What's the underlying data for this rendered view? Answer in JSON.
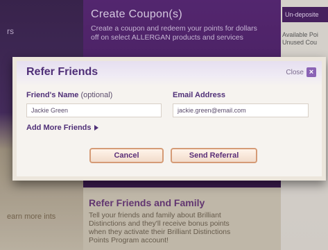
{
  "background": {
    "left_text": "rs",
    "left_bottom_text": "earn more ints",
    "coupon": {
      "title": "Create Coupon(s)",
      "description": "Create a coupon and redeem your points for dollars off on select ALLERGAN products and services"
    },
    "right_panel": {
      "undeposited_label": "Un-deposite",
      "available_text": "Available Poi\nUnused Cou"
    },
    "refer_section": {
      "title": "Refer Friends and Family",
      "description": "Tell your friends and family about Brilliant Distinctions and they'll receive bonus points when they activate their Brilliant Distinctions Points Program account!"
    }
  },
  "modal": {
    "title": "Refer Friends",
    "close_label": "Close",
    "friend_name_label": "Friend's Name",
    "friend_name_optional": "(optional)",
    "email_label": "Email Address",
    "friend_name_value": "Jackie Green",
    "email_value": "jackie.green@email.com",
    "add_more_label": "Add More Friends",
    "cancel_label": "Cancel",
    "send_label": "Send Referral"
  },
  "colors": {
    "accent_purple": "#4f2f77",
    "button_border": "#d59b76",
    "close_icon_bg": "#8a63b5"
  }
}
